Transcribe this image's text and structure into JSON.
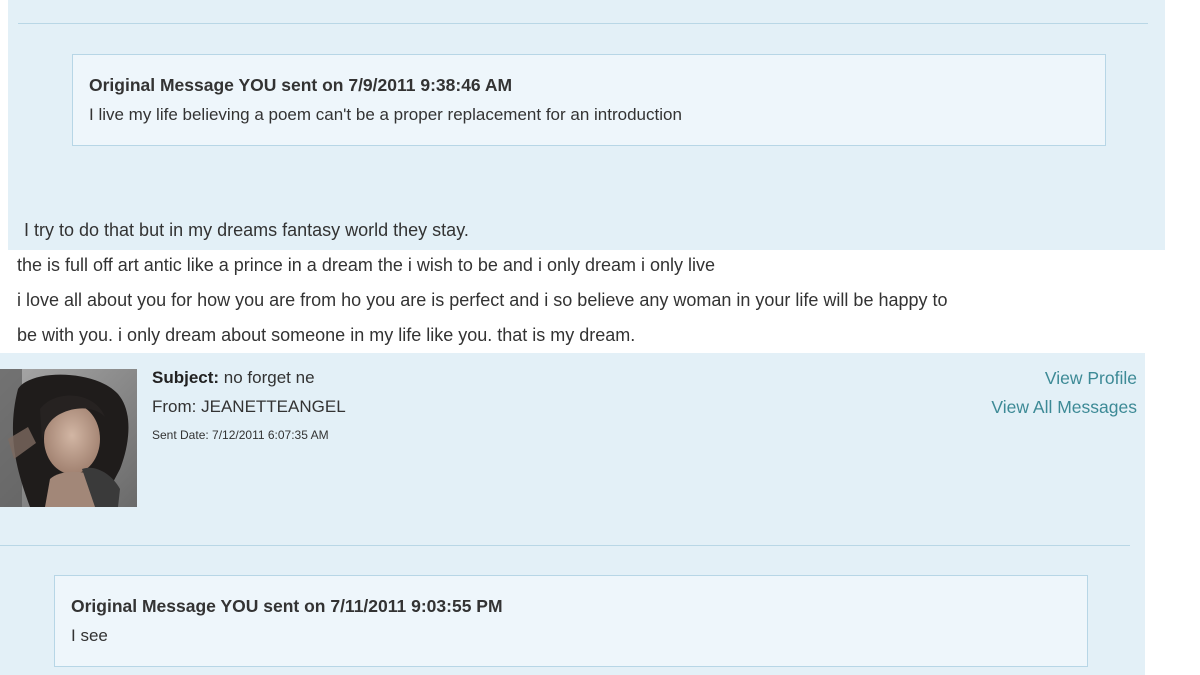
{
  "message_prev": {
    "original_header": "Original Message YOU sent on 7/9/2011 9:38:46 AM",
    "original_text": "I live my life believing a poem can't be a proper replacement for an introduction",
    "body_lines": [
      "I try to do that but in my dreams fantasy world they stay.",
      "the is full off art antic like a prince in a dream the i wish to be and i only dream i only live",
      "i love all about you for how you are from ho you are is perfect and i so believe any woman in your life will be happy to",
      "be with you. i only dream about someone in my life like you. that is my dream."
    ]
  },
  "message_next": {
    "subject_label": "Subject:",
    "subject_value": "no forget ne",
    "from_label": "From:",
    "from_value": "JEANETTEANGEL",
    "sent_date": "Sent Date: 7/12/2011 6:07:35 AM",
    "view_profile": "View Profile",
    "view_all_messages": "View All Messages",
    "original_header": "Original Message YOU sent on 7/11/2011 9:03:55 PM",
    "original_text": "I see"
  },
  "colors": {
    "panel_bg": "#e3f0f7",
    "box_bg": "#eef6fb",
    "box_border": "#b7d6e6",
    "link": "#3d8a96"
  }
}
